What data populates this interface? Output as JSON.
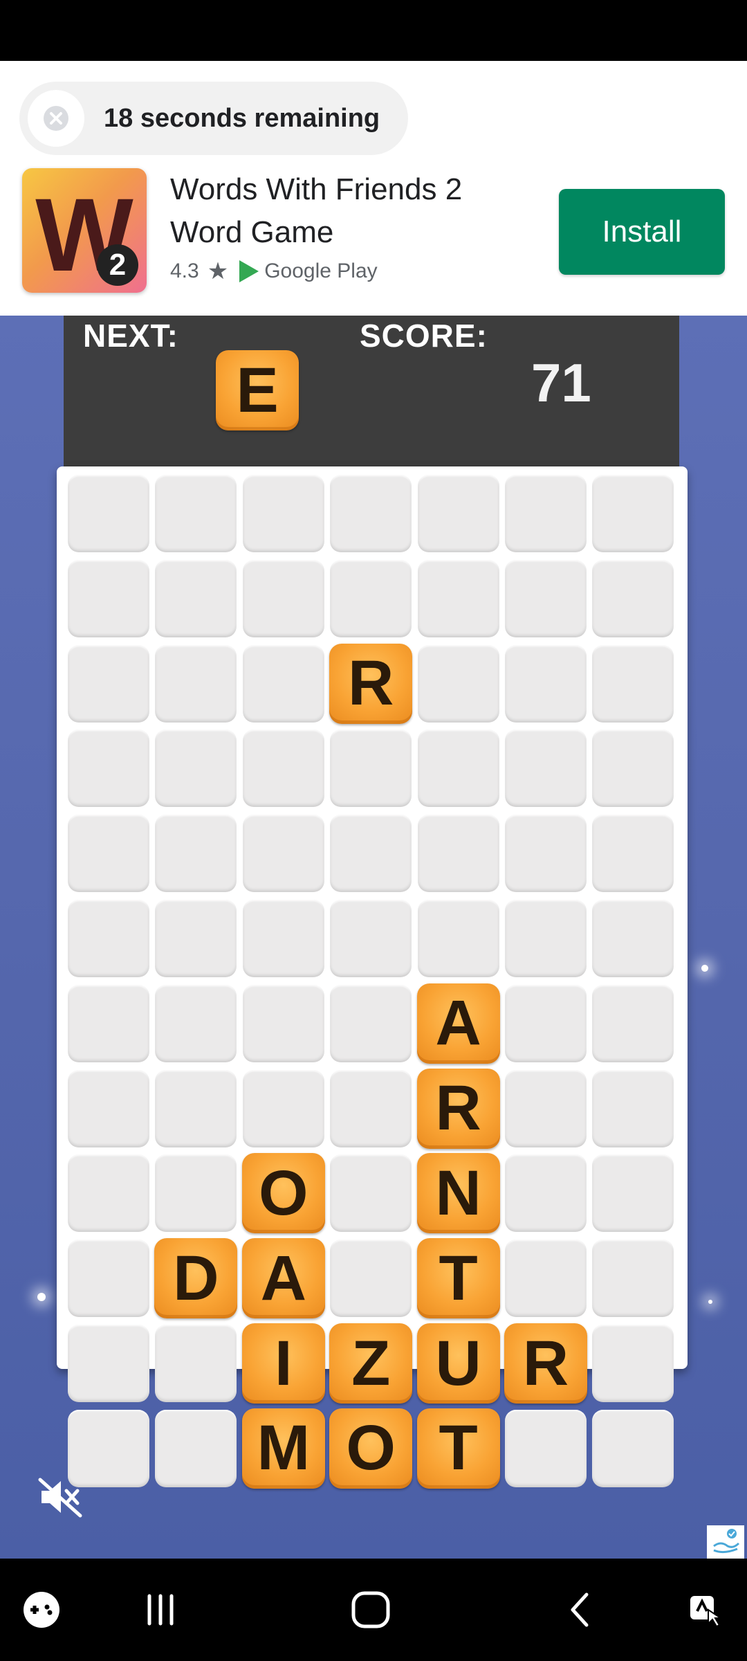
{
  "ad": {
    "timer_text": "18 seconds remaining",
    "app_icon_letter": "W",
    "app_icon_badge": "2",
    "app_title": "Words With Friends 2 Word Game",
    "rating": "4.3",
    "store_name": "Google Play",
    "install_label": "Install"
  },
  "game": {
    "next_label": "NEXT:",
    "next_letter": "E",
    "score_label": "SCORE:",
    "score_value": "71",
    "grid": {
      "columns": 7,
      "rows": 12,
      "tiles": [
        {
          "row": 2,
          "col": 3,
          "letter": "R"
        },
        {
          "row": 6,
          "col": 4,
          "letter": "A"
        },
        {
          "row": 7,
          "col": 4,
          "letter": "R"
        },
        {
          "row": 8,
          "col": 2,
          "letter": "O"
        },
        {
          "row": 8,
          "col": 4,
          "letter": "N"
        },
        {
          "row": 9,
          "col": 1,
          "letter": "D"
        },
        {
          "row": 9,
          "col": 2,
          "letter": "A"
        },
        {
          "row": 9,
          "col": 4,
          "letter": "T"
        },
        {
          "row": 10,
          "col": 2,
          "letter": "I"
        },
        {
          "row": 10,
          "col": 3,
          "letter": "Z"
        },
        {
          "row": 10,
          "col": 4,
          "letter": "U"
        },
        {
          "row": 10,
          "col": 5,
          "letter": "R"
        },
        {
          "row": 11,
          "col": 2,
          "letter": "M"
        },
        {
          "row": 11,
          "col": 3,
          "letter": "O"
        },
        {
          "row": 11,
          "col": 4,
          "letter": "T"
        }
      ]
    }
  },
  "icons": {
    "close": "close-icon",
    "star": "star-icon",
    "play_store": "google-play-icon",
    "mute": "volume-muted-icon",
    "ad_choices": "adchoices-icon",
    "nav": [
      "game-launcher-icon",
      "recents-icon",
      "home-icon",
      "back-icon",
      "accessibility-icon"
    ]
  },
  "colors": {
    "install": "#01875f",
    "tile": "#f9a334",
    "board_bg": "#5d6fb6",
    "scoreboard": "#3d3d3d"
  }
}
